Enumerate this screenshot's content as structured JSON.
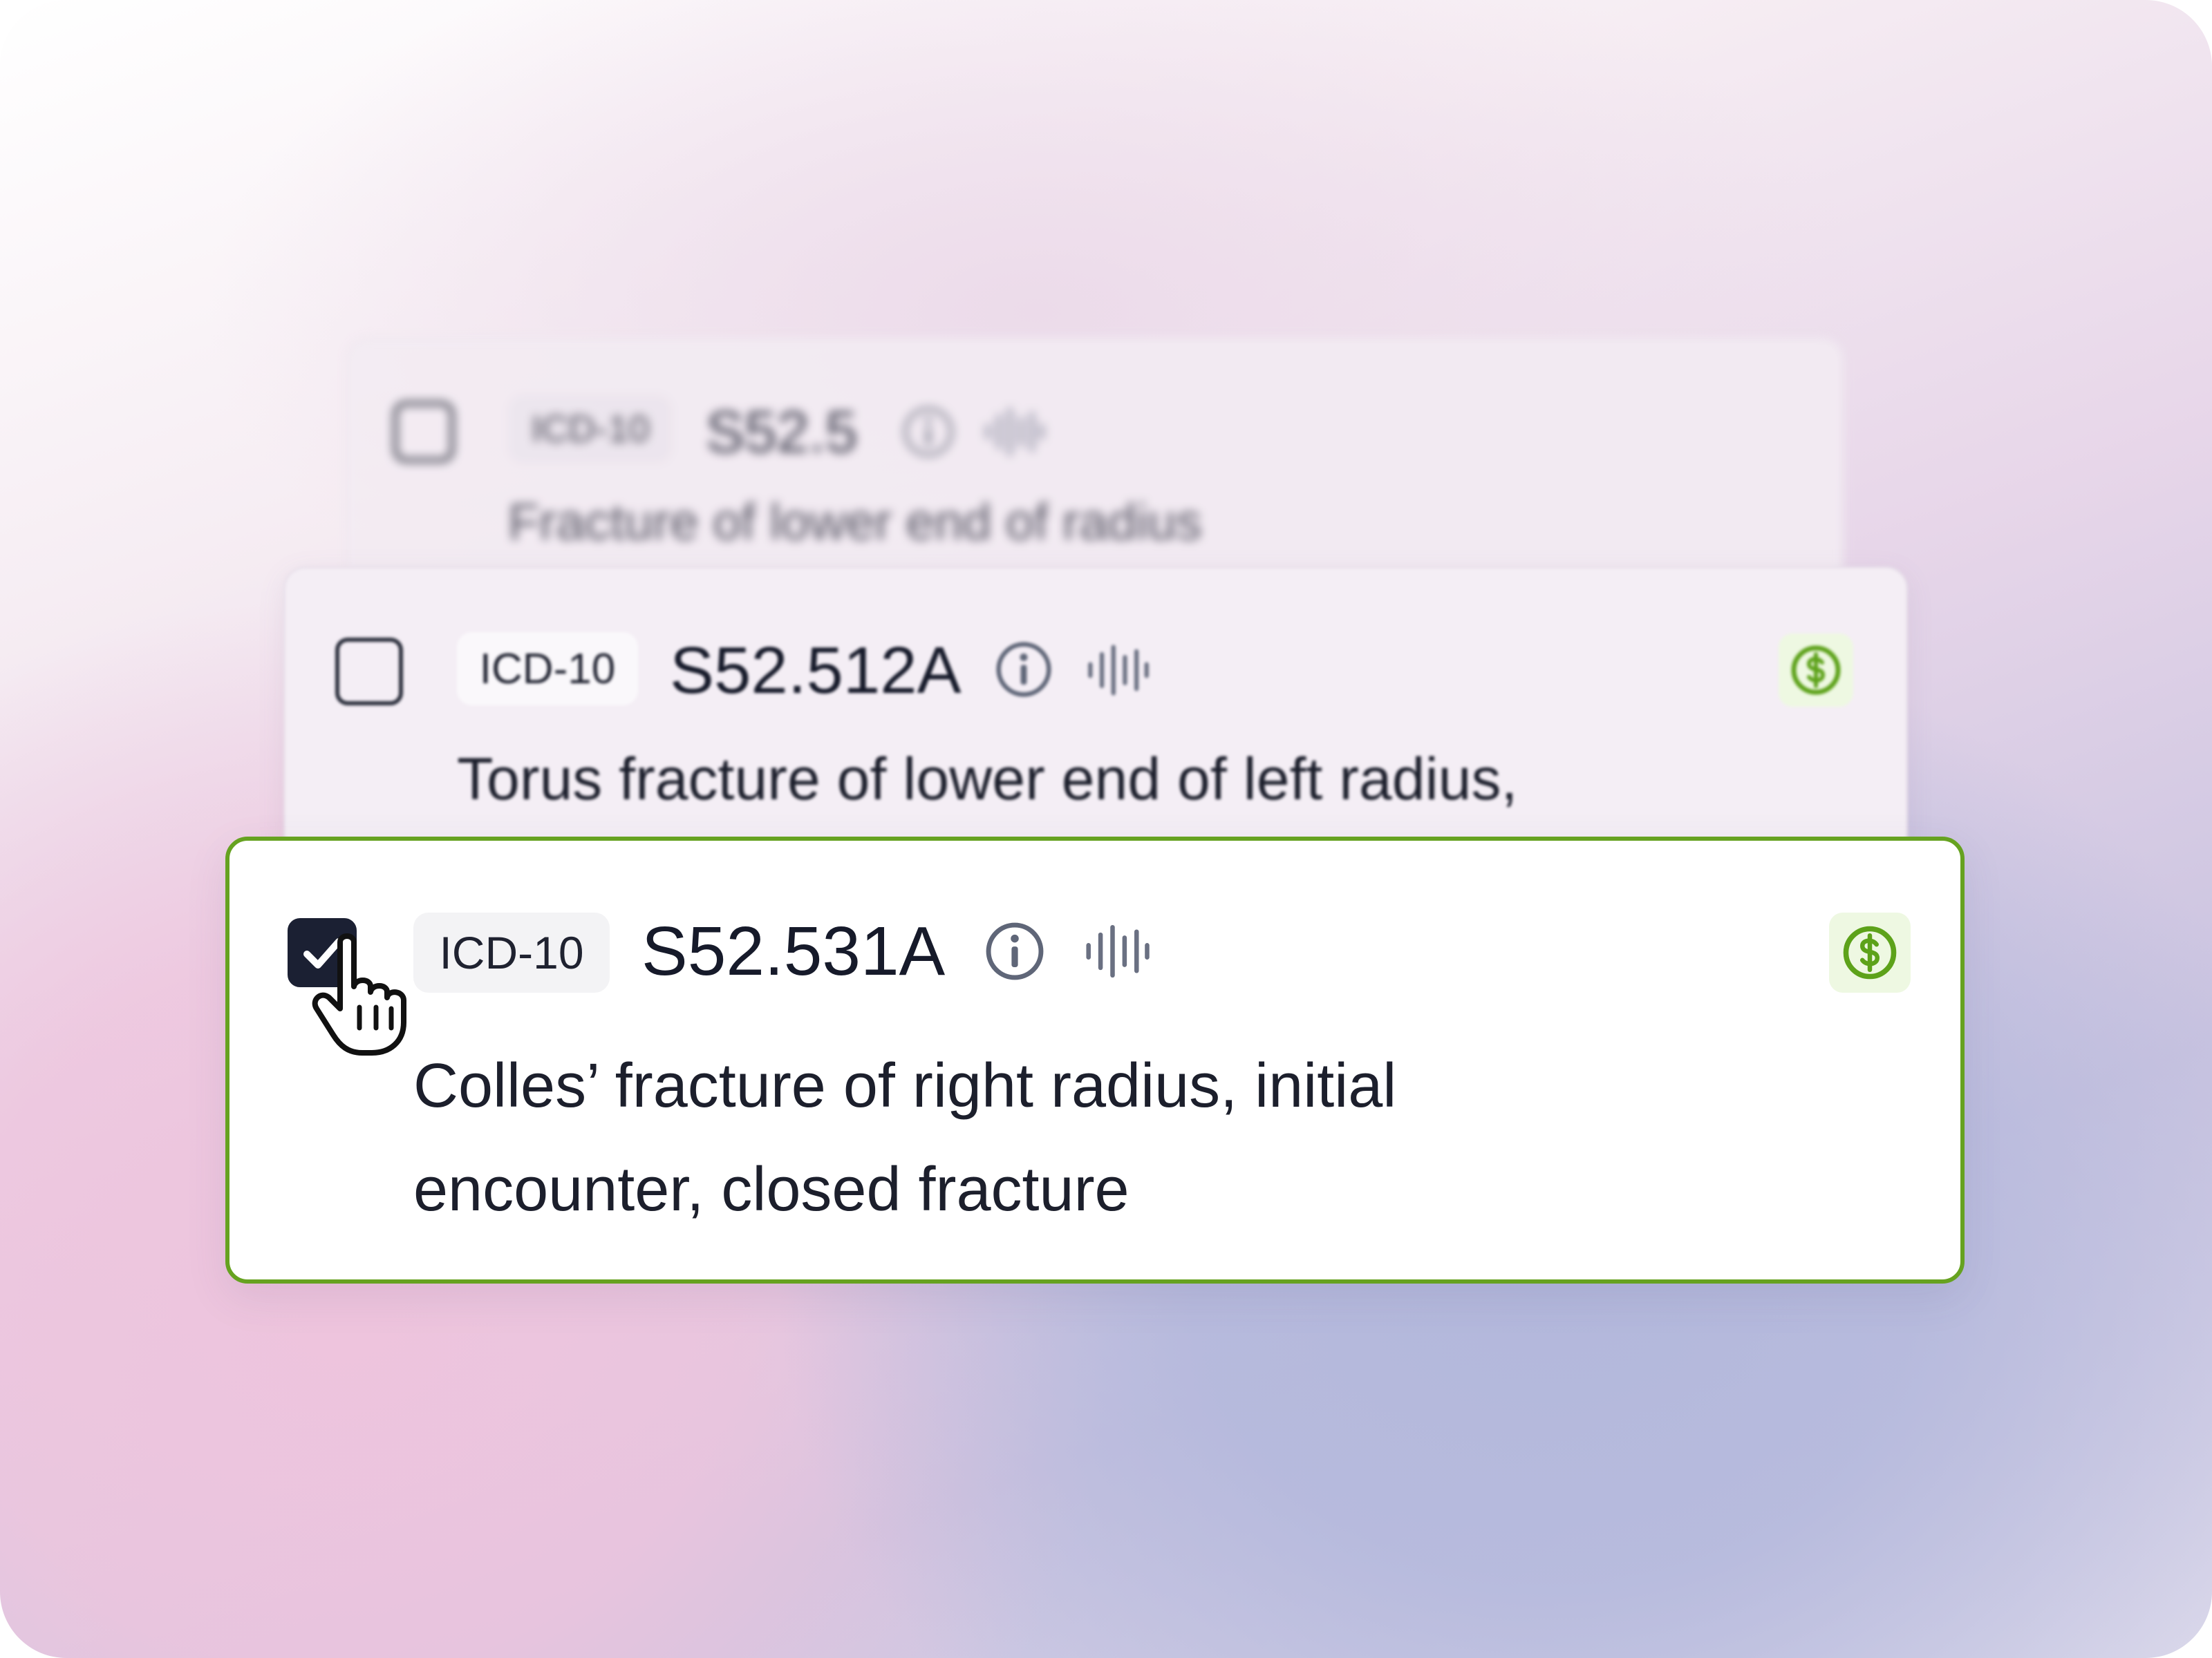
{
  "codes": [
    {
      "tag": "ICD-10",
      "code": "S52.5",
      "description": "Fracture of lower end of radius",
      "checked": false,
      "billable": false
    },
    {
      "tag": "ICD-10",
      "code": "S52.512A",
      "description": "Torus fracture of lower end of left radius,",
      "checked": false,
      "billable": true
    },
    {
      "tag": "ICD-10",
      "code": "S52.531A",
      "description_line1": "Colles’ fracture of right radius, initial",
      "description_line2": "encounter, closed fracture",
      "checked": true,
      "billable": true
    }
  ],
  "icons": {
    "info": "info-icon",
    "audio": "audio-waveform-icon",
    "billable": "dollar-icon",
    "cursor": "hand-pointer-icon",
    "check": "checkmark-icon"
  },
  "colors": {
    "selected_border": "#66a220",
    "billable_green": "#5da21a",
    "checkbox_fill": "#1b2033",
    "icon_gray": "#5f6678"
  }
}
